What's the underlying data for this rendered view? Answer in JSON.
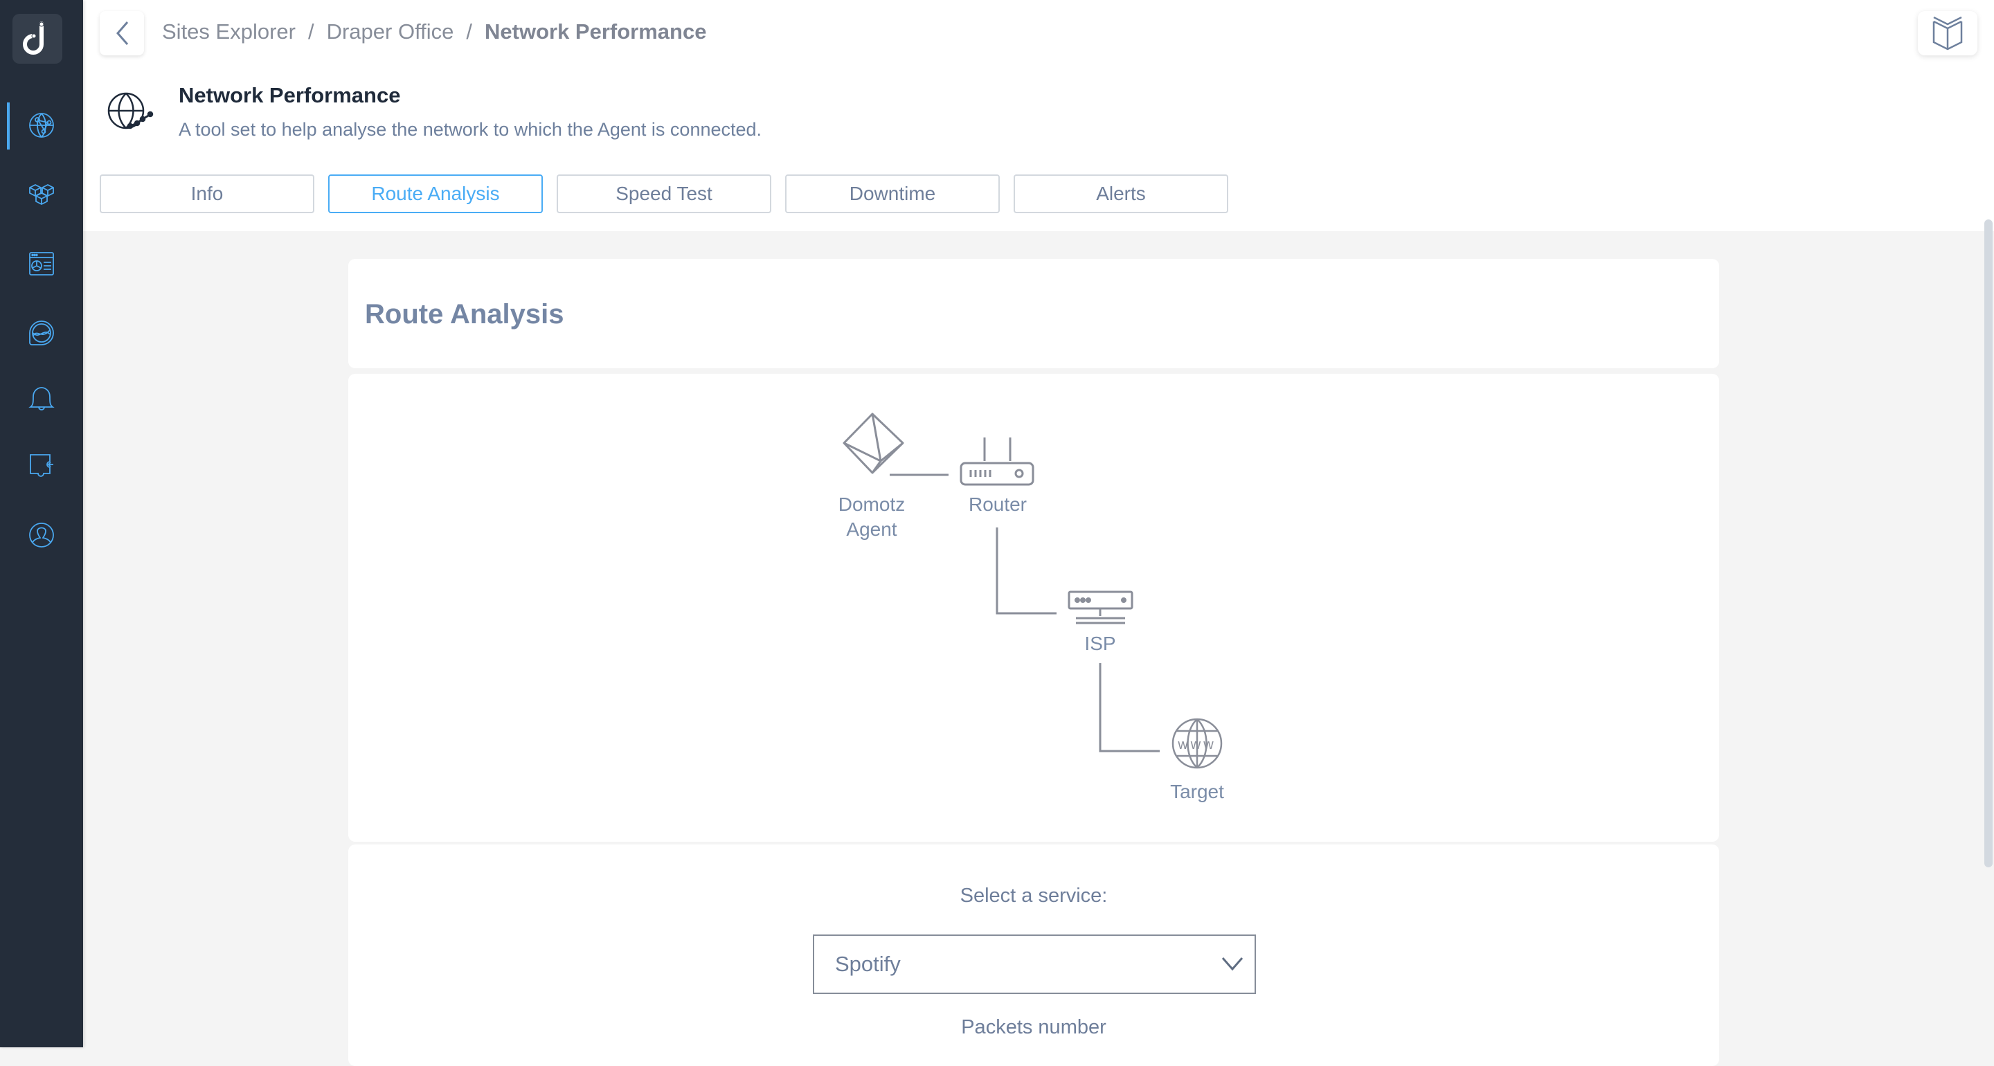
{
  "sidebar": {
    "logo": "domotz-logo",
    "items": [
      {
        "name": "sites-explorer",
        "icon": "globe-network-icon",
        "active": true
      },
      {
        "name": "devices",
        "icon": "cubes-icon",
        "active": false
      },
      {
        "name": "dashboard",
        "icon": "dashboard-window-icon",
        "active": false
      },
      {
        "name": "monitoring",
        "icon": "satellite-icon",
        "active": false
      },
      {
        "name": "alerts",
        "icon": "bell-icon",
        "active": false
      },
      {
        "name": "integrations",
        "icon": "puzzle-icon",
        "active": false
      },
      {
        "name": "account",
        "icon": "user-circle-icon",
        "active": false
      }
    ],
    "accent_color": "#4aa8f0"
  },
  "breadcrumb": {
    "items": [
      "Sites Explorer",
      "Draper Office",
      "Network Performance"
    ],
    "separator": "/"
  },
  "header": {
    "title": "Network Performance",
    "subtitle": "A tool set to help analyse the network to which the Agent is connected."
  },
  "tabs": [
    {
      "label": "Info",
      "active": false
    },
    {
      "label": "Route Analysis",
      "active": true
    },
    {
      "label": "Speed Test",
      "active": false
    },
    {
      "label": "Downtime",
      "active": false
    },
    {
      "label": "Alerts",
      "active": false
    }
  ],
  "route_analysis": {
    "title": "Route Analysis",
    "nodes": [
      {
        "label_line1": "Domotz",
        "label_line2": "Agent",
        "icon": "domotz-agent-icon"
      },
      {
        "label_line1": "Router",
        "icon": "router-icon"
      },
      {
        "label_line1": "ISP",
        "icon": "isp-server-icon"
      },
      {
        "label_line1": "Target",
        "icon": "www-globe-icon"
      }
    ]
  },
  "form": {
    "service_label": "Select a service:",
    "service_value": "Spotify",
    "packets_label": "Packets number"
  }
}
